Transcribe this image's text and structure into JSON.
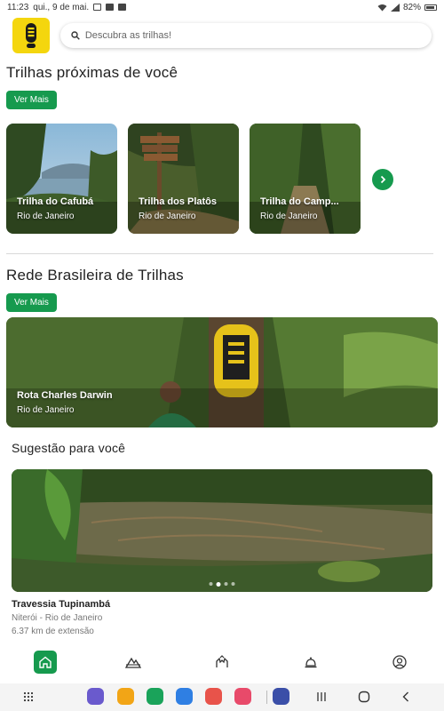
{
  "status_bar": {
    "time": "11:23",
    "date": "qui., 9 de mai.",
    "battery": "82%"
  },
  "header": {
    "logo_icon": "footprint-logo-icon",
    "search_placeholder": "Descubra as trilhas!"
  },
  "nearby": {
    "title": "Trilhas próximas de você",
    "more_label": "Ver Mais",
    "cards": [
      {
        "name": "Trilha do Cafubá",
        "location": "Rio de Janeiro"
      },
      {
        "name": "Trilha dos Platôs",
        "location": "Rio de Janeiro"
      },
      {
        "name": "Trilha do Camp...",
        "location": "Rio de Janeiro"
      }
    ]
  },
  "network": {
    "title": "Rede Brasileira de Trilhas",
    "more_label": "Ver Mais",
    "banner": {
      "name": "Rota Charles Darwin",
      "location": "Rio de Janeiro"
    }
  },
  "suggestion": {
    "title": "Sugestão para você",
    "item": {
      "name": "Travessia Tupinambá",
      "location": "Niterói - Rio de Janeiro",
      "distance": "6.37 km de extensão"
    },
    "carousel_count": 4,
    "carousel_active": 1
  },
  "bottom_nav": [
    "home-icon",
    "mountain-icon",
    "hands-icon",
    "bell-icon",
    "profile-icon"
  ],
  "colors": {
    "accent": "#169a4e",
    "logo": "#f4d60e"
  }
}
